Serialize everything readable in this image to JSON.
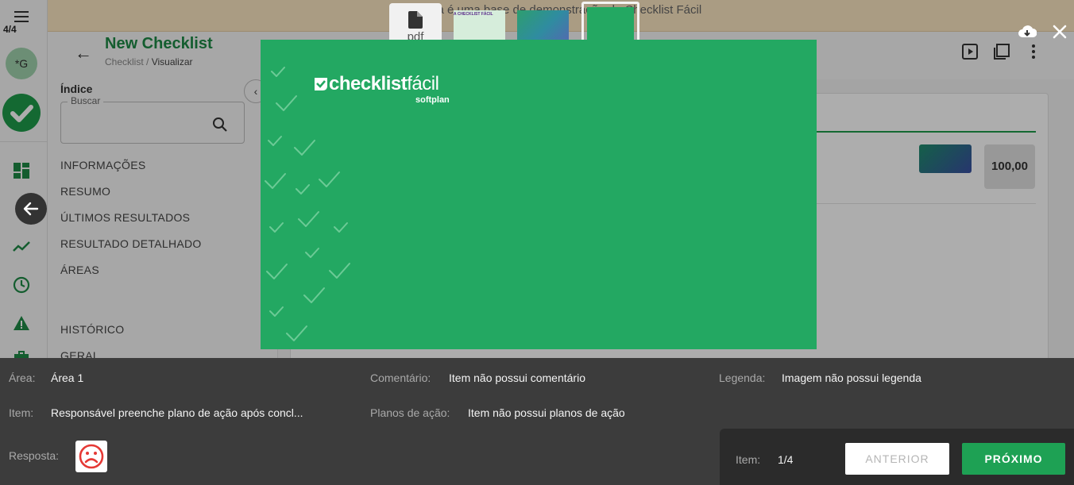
{
  "banner": {
    "text": "Esta é uma base de demonstração do Checklist Fácil"
  },
  "rail": {
    "counter": "4/4",
    "avatar": "*G"
  },
  "header": {
    "title": "New Checklist",
    "crumb_root": "Checklist",
    "crumb_sep": " / ",
    "crumb_current": "Visualizar"
  },
  "index": {
    "title": "Índice",
    "search_label": "Buscar",
    "items": [
      "INFORMAÇÕES",
      "RESUMO",
      "ÚLTIMOS RESULTADOS",
      "RESULTADO DETALHADO",
      "ÁREAS",
      "HISTÓRICO",
      "GERAL"
    ]
  },
  "card": {
    "score": "100,00"
  },
  "viewer": {
    "pdf_label": "pdf",
    "thumb1_text": "A CHECKLIST FÁCIL",
    "logo_brand": "checklist",
    "logo_brand2": "fácil",
    "logo_sub": "softplan",
    "icons": [
      "download-icon",
      "close-icon",
      "arrow-left-icon",
      "file-icon"
    ]
  },
  "info": {
    "area_label": "Área:",
    "area_value": "Área 1",
    "comment_label": "Comentário:",
    "comment_value": "Item não possui comentário",
    "legend_label": "Legenda:",
    "legend_value": "Imagem não possui legenda",
    "item_label": "Item:",
    "item_value": "Responsável preenche plano de ação após concl...",
    "plans_label": "Planos de ação:",
    "plans_value": "Item não possui planos de ação",
    "answer_label": "Resposta:"
  },
  "nav": {
    "item_label": "Item:",
    "item_value": "1/4",
    "prev_label": "ANTERIOR",
    "next_label": "PRÓXIMO"
  },
  "colors": {
    "brand_green": "#23a862",
    "button_green": "#1ea154",
    "sad_red": "#e53935"
  }
}
